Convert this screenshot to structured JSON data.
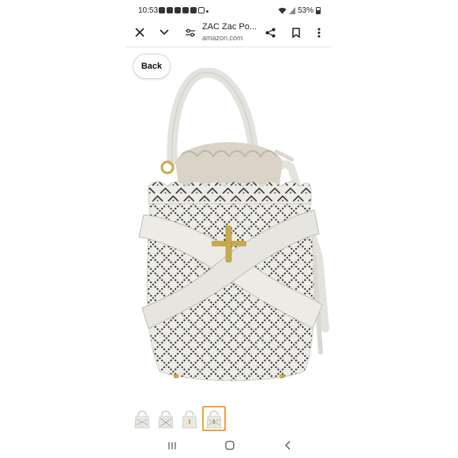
{
  "status_bar": {
    "time": "10:53",
    "battery": "53%",
    "notification_icons": [
      "notification-icon",
      "youtube-icon",
      "youtube-icon",
      "hand-icon",
      "photos-icon",
      "link-icon"
    ]
  },
  "browser": {
    "page_title": "ZAC Zac Po...",
    "domain": "amazon.com"
  },
  "back_button": {
    "label": "Back"
  },
  "product": {
    "image_description_icon": "white-perforated-bucket-bag-image"
  },
  "thumbnails": {
    "count": 4,
    "selected_index": 3
  },
  "colors": {
    "accent": "#f0a23c",
    "bag": "#ecebe6"
  }
}
